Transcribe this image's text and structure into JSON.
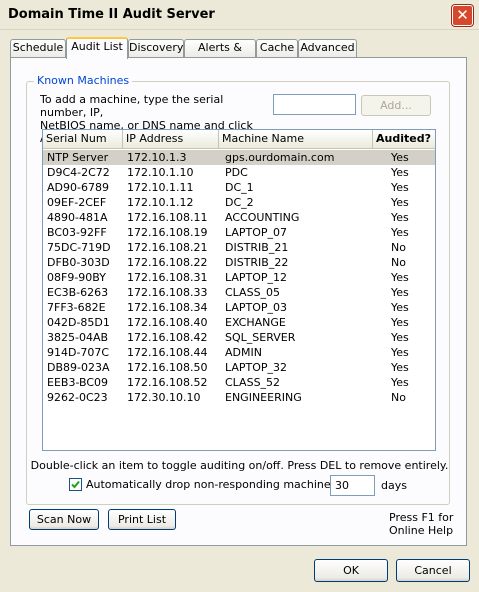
{
  "window": {
    "title": "Domain Time II Audit Server"
  },
  "tabs": [
    "Schedule",
    "Audit List",
    "Discovery",
    "Alerts & Logs",
    "Cache",
    "Advanced"
  ],
  "known_machines": {
    "group_label": "Known Machines",
    "instruction_line1": "To add a machine, type the serial number, IP,",
    "instruction_line2": "NetBIOS name, or DNS name and click Add:",
    "add_value": "",
    "add_button": "Add..."
  },
  "table": {
    "columns": [
      "Serial Num",
      "IP Address",
      "Machine Name",
      "Audited?"
    ],
    "rows": [
      [
        "NTP Server",
        "172.10.1.3",
        "gps.ourdomain.com",
        "Yes"
      ],
      [
        "D9C4-2C72",
        "172.10.1.10",
        "PDC",
        "Yes"
      ],
      [
        "AD90-6789",
        "172.10.1.11",
        "DC_1",
        "Yes"
      ],
      [
        "09EF-2CEF",
        "172.10.1.12",
        "DC_2",
        "Yes"
      ],
      [
        "4890-481A",
        "172.16.108.11",
        "ACCOUNTING",
        "Yes"
      ],
      [
        "BC03-92FF",
        "172.16.108.19",
        "LAPTOP_07",
        "Yes"
      ],
      [
        "75DC-719D",
        "172.16.108.21",
        "DISTRIB_21",
        "No"
      ],
      [
        "DFB0-303D",
        "172.16.108.22",
        "DISTRIB_22",
        "No"
      ],
      [
        "08F9-90BY",
        "172.16.108.31",
        "LAPTOP_12",
        "Yes"
      ],
      [
        "EC3B-6263",
        "172.16.108.33",
        "CLASS_05",
        "Yes"
      ],
      [
        "7FF3-682E",
        "172.16.108.34",
        "LAPTOP_03",
        "Yes"
      ],
      [
        "042D-85D1",
        "172.16.108.40",
        "EXCHANGE",
        "Yes"
      ],
      [
        "3825-04AB",
        "172.16.108.42",
        "SQL_SERVER",
        "Yes"
      ],
      [
        "914D-707C",
        "172.16.108.44",
        "ADMIN",
        "Yes"
      ],
      [
        "DB89-023A",
        "172.16.108.50",
        "LAPTOP_32",
        "Yes"
      ],
      [
        "EEB3-BC09",
        "172.16.108.52",
        "CLASS_52",
        "Yes"
      ],
      [
        "9262-0C23",
        "172.30.10.10",
        "ENGINEERING",
        "No"
      ]
    ]
  },
  "hint": "Double-click an item to toggle auditing on/off. Press DEL to remove entirely.",
  "auto_drop": {
    "checked": true,
    "label": "Automatically drop non-responding machines after",
    "days_value": "30",
    "days_label": "days"
  },
  "buttons": {
    "scan_now": "Scan Now",
    "print_list": "Print List",
    "ok": "OK",
    "cancel": "Cancel"
  },
  "help_text": {
    "line1": "Press F1 for",
    "line2": "Online Help"
  },
  "colors": {
    "face": "#ECE9D8",
    "close_red": "#D6482B",
    "tab_highlight": "#FFC83C",
    "group_label": "#0046D5"
  }
}
